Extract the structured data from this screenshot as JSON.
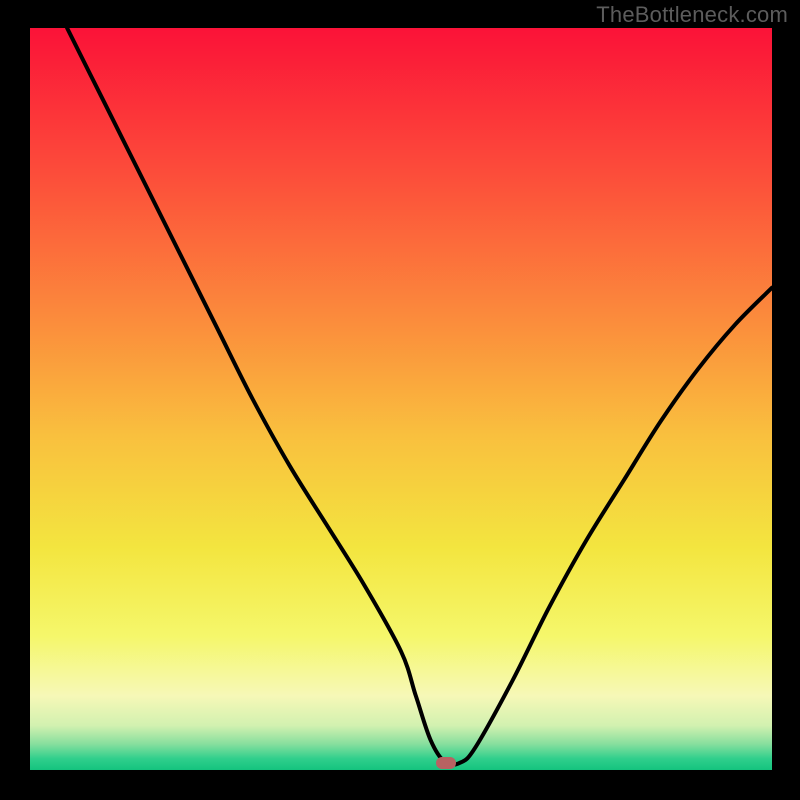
{
  "watermark": "TheBottleneck.com",
  "chart_data": {
    "type": "line",
    "title": "",
    "xlabel": "",
    "ylabel": "",
    "xlim": [
      0,
      100
    ],
    "ylim": [
      0,
      100
    ],
    "series": [
      {
        "name": "bottleneck-curve",
        "x": [
          5,
          10,
          15,
          20,
          25,
          30,
          35,
          40,
          45,
          50,
          52,
          54,
          56,
          58,
          60,
          65,
          70,
          75,
          80,
          85,
          90,
          95,
          100
        ],
        "y": [
          100,
          90,
          80,
          70,
          60,
          50,
          41,
          33,
          25,
          16,
          10,
          4,
          1,
          1,
          3,
          12,
          22,
          31,
          39,
          47,
          54,
          60,
          65
        ]
      }
    ],
    "marker": {
      "x": 56,
      "y": 1,
      "label": "optimal-point"
    },
    "gradient_stops": [
      {
        "pos": 0.0,
        "color": "#fb1238"
      },
      {
        "pos": 0.2,
        "color": "#fc4e3a"
      },
      {
        "pos": 0.4,
        "color": "#fb8e3c"
      },
      {
        "pos": 0.55,
        "color": "#f9c03e"
      },
      {
        "pos": 0.7,
        "color": "#f3e53f"
      },
      {
        "pos": 0.82,
        "color": "#f5f76b"
      },
      {
        "pos": 0.9,
        "color": "#f6f8b7"
      },
      {
        "pos": 0.94,
        "color": "#d2f1b0"
      },
      {
        "pos": 0.965,
        "color": "#87df9e"
      },
      {
        "pos": 0.985,
        "color": "#2fcf8c"
      },
      {
        "pos": 1.0,
        "color": "#14c37e"
      }
    ]
  }
}
